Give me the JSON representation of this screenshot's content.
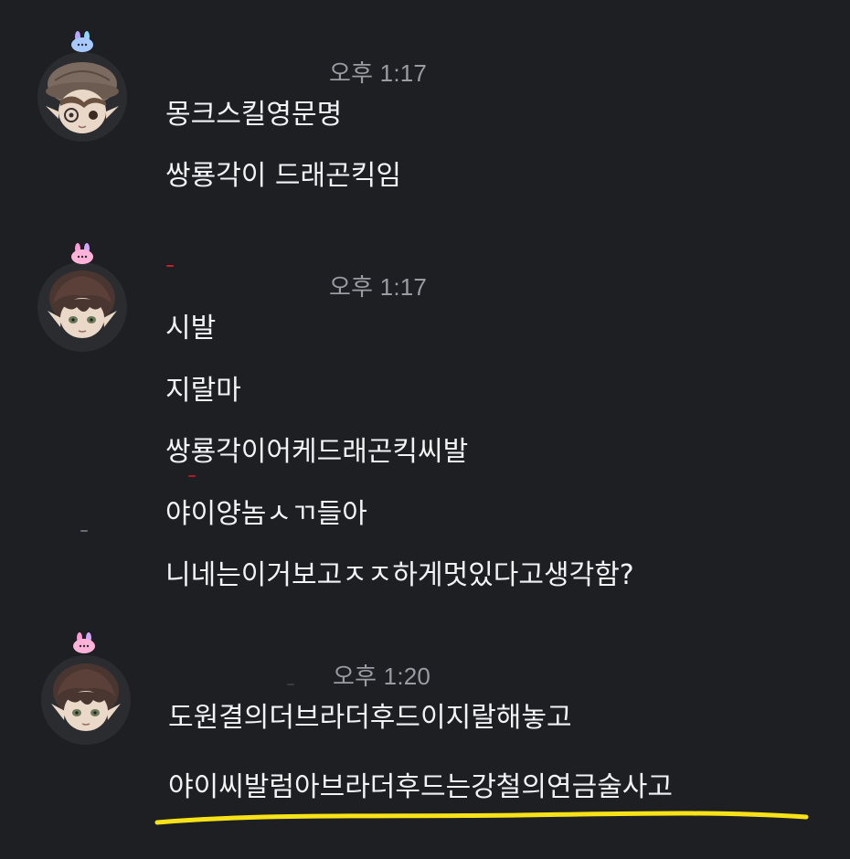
{
  "messages": [
    {
      "author_avatar": "avatar-brown-hat-character",
      "badge": "bunny-badge-blue",
      "timestamp": "오후 1:17",
      "lines": [
        "몽크스킬영문명",
        "쌍룡각이 드래곤킥임"
      ]
    },
    {
      "author_avatar": "avatar-dark-hair-character",
      "badge": "bunny-badge-pink",
      "timestamp": "오후 1:17",
      "lines": [
        "시발",
        "지랄마",
        "쌍룡각이어케드래곤킥씨발",
        "야이양놈ㅅㄲ들아",
        "니네는이거보고ㅈㅈ하게멋있다고생각함?"
      ]
    },
    {
      "author_avatar": "avatar-dark-hair-character",
      "badge": "bunny-badge-pink",
      "timestamp": "오후 1:20",
      "lines": [
        "도원결의더브라더후드이지랄해놓고",
        "야이씨발럼아브라더후드는강철의연금술사고"
      ]
    }
  ],
  "colors": {
    "background": "#1e1f22",
    "message_text": "#f2f3f5",
    "timestamp_text": "#9b9ca3",
    "highlight_underline": "#f7e21a"
  }
}
